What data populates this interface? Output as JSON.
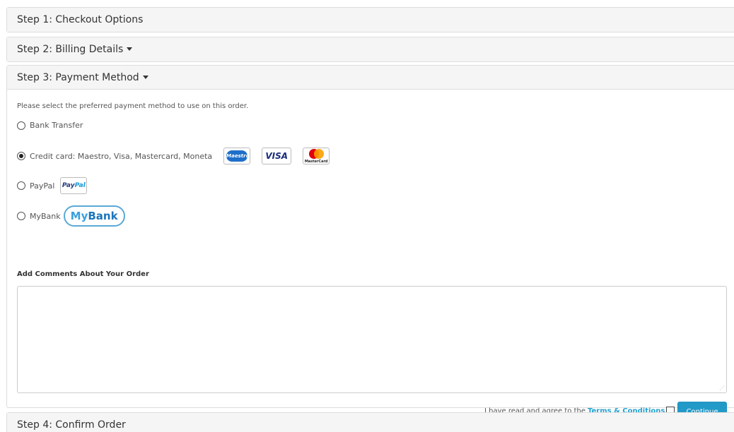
{
  "steps": [
    {
      "label": "Step 1: Checkout Options"
    },
    {
      "label": "Step 2: Billing Details"
    },
    {
      "label": "Step 3: Payment Method"
    },
    {
      "label": "Step 4: Confirm Order"
    }
  ],
  "payment": {
    "intro": "Please select the preferred payment method to use on this order.",
    "methods": [
      {
        "label": "Bank Transfer",
        "selected": false
      },
      {
        "label": "Credit card: Maestro, Visa, Mastercard, Moneta",
        "selected": true,
        "logos": [
          "maestro-logo",
          "visa-logo",
          "mastercard-logo"
        ]
      },
      {
        "label": "PayPal",
        "selected": false,
        "logos": [
          "paypal-logo"
        ]
      },
      {
        "label": "MyBank",
        "selected": false,
        "logos": [
          "mybank-logo"
        ]
      }
    ],
    "logo_text": {
      "maestro": "Maestro",
      "visa": "VISA",
      "mastercard": "MasterCard",
      "paypal_a": "Pay",
      "paypal_b": "Pal",
      "mybank_a": "My",
      "mybank_b": "Bank"
    }
  },
  "comments": {
    "label": "Add Comments About Your Order",
    "value": ""
  },
  "agreement": {
    "text": "I have read and agree to the",
    "link": "Terms & Conditions",
    "checked": false
  },
  "continue_label": "Continue",
  "colors": {
    "accent": "#229ac8",
    "link": "#23a1d1",
    "panel_heading_bg": "#f5f5f5",
    "border": "#dddddd"
  }
}
